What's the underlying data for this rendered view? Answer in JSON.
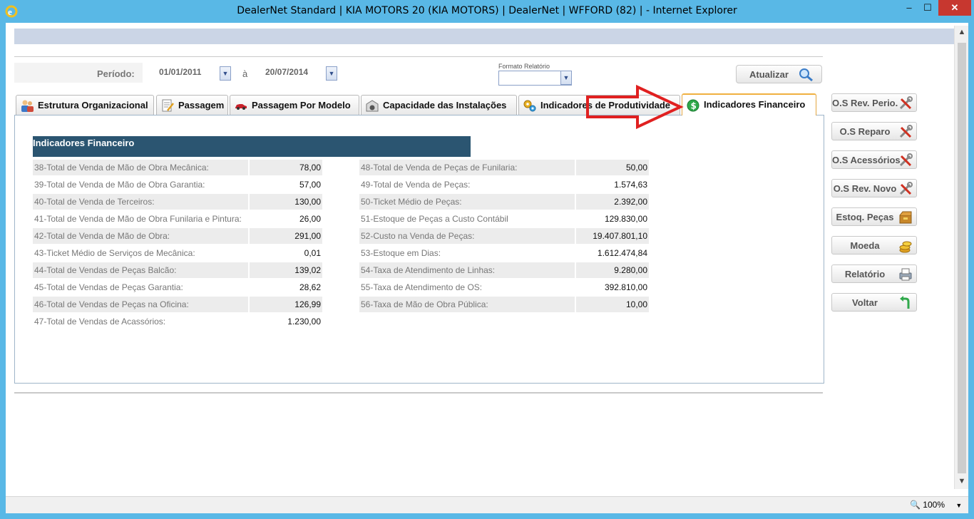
{
  "window": {
    "title": "DealerNet Standard | KIA MOTORS 20 (KIA MOTORS) | DealerNet | WFFORD (82) | - Internet Explorer",
    "min_glyph": "–",
    "max_glyph": "☐",
    "close_glyph": "✕"
  },
  "status": {
    "zoom": "100%"
  },
  "filters": {
    "periodo_label": "Período:",
    "date_from": "01/01/2011",
    "to_label": "à",
    "date_to": "20/07/2014",
    "formato_label": "Formato Relatório",
    "formato_value": "",
    "atualizar_label": "Atualizar"
  },
  "tabs": [
    {
      "label": "Estrutura Organizacional",
      "icon": "people-icon"
    },
    {
      "label": "Passagem",
      "icon": "notepad-icon"
    },
    {
      "label": "Passagem Por Modelo",
      "icon": "car-icon"
    },
    {
      "label": "Capacidade das Instalações",
      "icon": "garage-icon"
    },
    {
      "label": "Indicadores de Produtividade",
      "icon": "gears-icon"
    },
    {
      "label": "Indicadores Financeiro",
      "icon": "dollar-icon",
      "active": true
    }
  ],
  "section_title": "Indicadores Financeiro",
  "left_indicators": [
    {
      "label": "38-Total de Venda de Mão de Obra Mecânica:",
      "value": "78,00"
    },
    {
      "label": "39-Total de Venda de Mão de Obra Garantia:",
      "value": "57,00"
    },
    {
      "label": "40-Total de Venda de Terceiros:",
      "value": "130,00"
    },
    {
      "label": "41-Total de Venda de Mão de Obra Funilaria e Pintura:",
      "value": "26,00"
    },
    {
      "label": "42-Total de Venda de Mão de Obra:",
      "value": "291,00"
    },
    {
      "label": "43-Ticket Médio de Serviços de Mecânica:",
      "value": "0,01"
    },
    {
      "label": "44-Total de Vendas de Peças Balcão:",
      "value": "139,02"
    },
    {
      "label": "45-Total de Vendas de Peças Garantia:",
      "value": "28,62"
    },
    {
      "label": "46-Total de Vendas de Peças na Oficina:",
      "value": "126,99"
    },
    {
      "label": "47-Total de Vendas de Acassórios:",
      "value": "1.230,00"
    }
  ],
  "right_indicators": [
    {
      "label": "48-Total de Venda de Peças de Funilaria:",
      "value": "50,00"
    },
    {
      "label": "49-Total de Venda de Peças:",
      "value": "1.574,63"
    },
    {
      "label": "50-Ticket Médio de Peças:",
      "value": "2.392,00"
    },
    {
      "label": "51-Estoque de Peças a Custo Contábil",
      "value": "129.830,00"
    },
    {
      "label": "52-Custo na Venda de Peças:",
      "value": "19.407.801,10"
    },
    {
      "label": "53-Estoque em Dias:",
      "value": "1.612.474,84"
    },
    {
      "label": "54-Taxa de Atendimento de Linhas:",
      "value": "9.280,00"
    },
    {
      "label": "55-Taxa de Atendimento de OS:",
      "value": "392.810,00"
    },
    {
      "label": "56-Taxa de Mão de Obra Pública:",
      "value": "10,00"
    }
  ],
  "side_buttons": [
    {
      "label": "O.S Rev. Perio.",
      "icon": "tools-icon"
    },
    {
      "label": "O.S Reparo",
      "icon": "tools-icon"
    },
    {
      "label": "O.S Acessórios",
      "icon": "tools-icon"
    },
    {
      "label": "O.S Rev. Novo",
      "icon": "tools-icon"
    },
    {
      "label": "Estoq. Peças",
      "icon": "box-icon"
    },
    {
      "label": "Moeda",
      "icon": "coins-icon"
    },
    {
      "label": "Relatório",
      "icon": "printer-icon"
    },
    {
      "label": "Voltar",
      "icon": "back-arrow-icon"
    }
  ],
  "colors": {
    "section_header": "#2b5571",
    "annotation_arrow": "#e02020",
    "active_tab_border": "#f0b040"
  }
}
